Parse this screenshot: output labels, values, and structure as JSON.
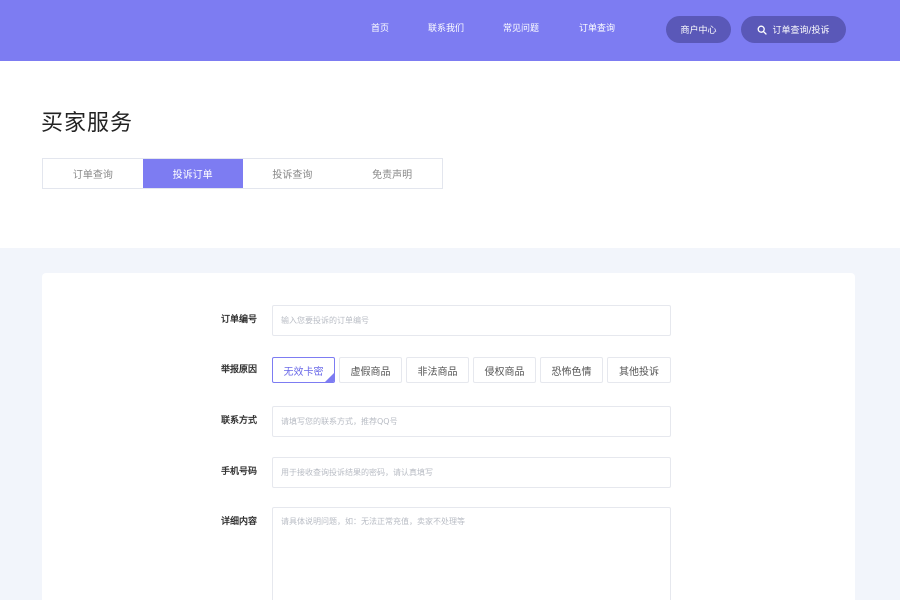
{
  "nav": {
    "links": [
      "首页",
      "联系我们",
      "常见问题",
      "订单查询"
    ],
    "merchant_center": "商户中心",
    "order_search_complaint": "订单查询/投诉"
  },
  "page": {
    "title": "买家服务"
  },
  "tabs": [
    {
      "label": "订单查询",
      "active": false
    },
    {
      "label": "投诉订单",
      "active": true
    },
    {
      "label": "投诉查询",
      "active": false
    },
    {
      "label": "免责声明",
      "active": false
    }
  ],
  "form": {
    "order_no": {
      "label": "订单编号",
      "placeholder": "输入您要投诉的订单编号"
    },
    "reason": {
      "label": "举报原因",
      "options": [
        "无效卡密",
        "虚假商品",
        "非法商品",
        "侵权商品",
        "恐怖色情",
        "其他投诉"
      ],
      "selected": "无效卡密"
    },
    "contact": {
      "label": "联系方式",
      "placeholder": "请填写您的联系方式，推荐QQ号"
    },
    "phone": {
      "label": "手机号码",
      "placeholder": "用于接收查询投诉结果的密码，请认真填写"
    },
    "detail": {
      "label": "详细内容",
      "placeholder": "请具体说明问题，如：无法正常充值，卖家不处理等"
    }
  },
  "colors": {
    "accent": "#7d7cf2",
    "accent_dark": "#5a58b8",
    "page_bg": "#f2f5fb"
  }
}
